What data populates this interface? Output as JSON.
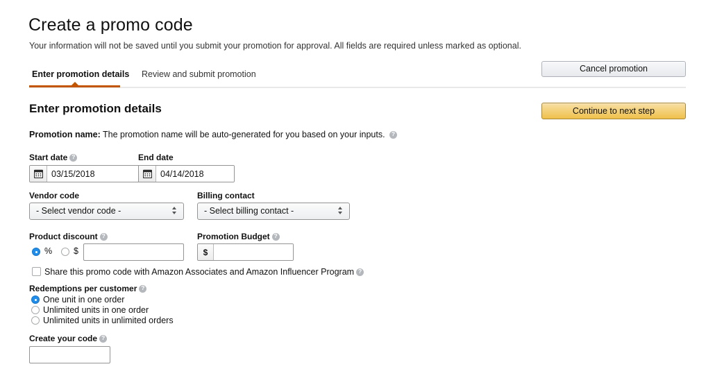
{
  "header": {
    "title": "Create a promo code",
    "subtitle": "Your information will not be saved until you submit your promotion for approval. All fields are required unless marked as optional."
  },
  "tabs": [
    {
      "label": "Enter promotion details",
      "active": true
    },
    {
      "label": "Review and submit promotion",
      "active": false
    }
  ],
  "actions": {
    "cancel_label": "Cancel promotion",
    "continue_label": "Continue to next step"
  },
  "section": {
    "title": "Enter promotion details",
    "promo_name_label": "Promotion name:",
    "promo_name_text": "The promotion name will be auto-generated for you based on your inputs."
  },
  "fields": {
    "start_date": {
      "label": "Start date",
      "value": "03/15/2018",
      "icon": "calendar-icon",
      "has_help": true
    },
    "end_date": {
      "label": "End date",
      "value": "04/14/2018",
      "icon": "calendar-icon",
      "has_help": false
    },
    "vendor_code": {
      "label": "Vendor code",
      "selected": "- Select vendor code -",
      "options": [
        "- Select vendor code -"
      ]
    },
    "billing_contact": {
      "label": "Billing contact",
      "selected": "- Select billing contact -",
      "options": [
        "- Select billing contact -"
      ]
    },
    "product_discount": {
      "label": "Product discount",
      "has_help": true,
      "options": [
        {
          "label": "%",
          "selected": true
        },
        {
          "label": "$",
          "selected": false
        }
      ],
      "value": "",
      "placeholder": ""
    },
    "promotion_budget": {
      "label": "Promotion Budget",
      "has_help": true,
      "prefix": "$",
      "value": "",
      "placeholder": ""
    },
    "share_checkbox": {
      "label": "Share this promo code with Amazon Associates and Amazon Influencer Program",
      "checked": false,
      "has_help": true
    },
    "redemptions": {
      "label": "Redemptions per customer",
      "has_help": true,
      "options": [
        {
          "label": "One unit in one order",
          "selected": true
        },
        {
          "label": "Unlimited units in one order",
          "selected": false
        },
        {
          "label": "Unlimited units in unlimited orders",
          "selected": false
        }
      ]
    },
    "create_code": {
      "label": "Create your code",
      "has_help": true,
      "value": "",
      "placeholder": ""
    }
  },
  "colors": {
    "accent_orange": "#c45500",
    "gold_button_top": "#f7dfa5",
    "gold_button_bottom": "#f0c14b",
    "radio_blue": "#1f8deb",
    "border_gray": "#949494"
  }
}
